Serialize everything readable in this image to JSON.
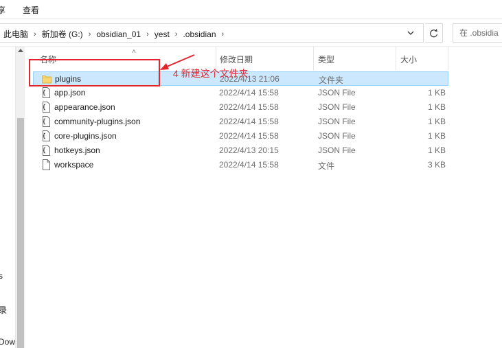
{
  "ribbon": {
    "tab_partial": "享",
    "tab_view": "查看"
  },
  "address": {
    "crumbs": [
      "此电脑",
      "新加卷 (G:)",
      "obsidian_01",
      "yest",
      ".obsidian"
    ],
    "search_placeholder": "在 .obsidia"
  },
  "nav": {
    "fragments": [
      "s",
      "录",
      "Dow"
    ]
  },
  "columns": {
    "name": "名称",
    "date": "修改日期",
    "type": "类型",
    "size": "大小"
  },
  "files": [
    {
      "name": "plugins",
      "date": "2022/4/13 21:06",
      "type": "文件夹",
      "size": "",
      "icon": "folder-icon",
      "selected": true
    },
    {
      "name": "app.json",
      "date": "2022/4/14 15:58",
      "type": "JSON File",
      "size": "1 KB",
      "icon": "json-file-icon"
    },
    {
      "name": "appearance.json",
      "date": "2022/4/14 15:58",
      "type": "JSON File",
      "size": "1 KB",
      "icon": "json-file-icon"
    },
    {
      "name": "community-plugins.json",
      "date": "2022/4/14 15:58",
      "type": "JSON File",
      "size": "1 KB",
      "icon": "json-file-icon"
    },
    {
      "name": "core-plugins.json",
      "date": "2022/4/14 15:58",
      "type": "JSON File",
      "size": "1 KB",
      "icon": "json-file-icon"
    },
    {
      "name": "hotkeys.json",
      "date": "2022/4/13 20:15",
      "type": "JSON File",
      "size": "1 KB",
      "icon": "json-file-icon"
    },
    {
      "name": "workspace",
      "date": "2022/4/14 15:58",
      "type": "文件",
      "size": "3 KB",
      "icon": "blank-file-icon"
    }
  ],
  "annotation": {
    "text": "4 新建这个文件夹",
    "color": "#e3262e"
  },
  "colors": {
    "selection_bg": "#cce8ff",
    "selection_border": "#99d1ff",
    "folder": "#f7d774"
  }
}
